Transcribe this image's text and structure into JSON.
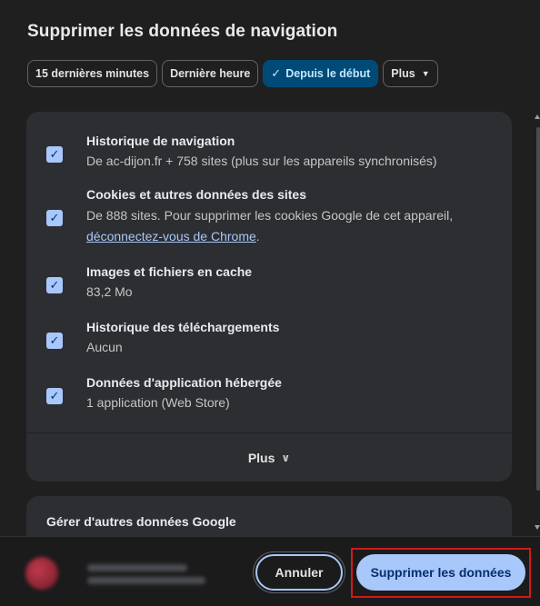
{
  "dialog": {
    "title": "Supprimer les données de navigation"
  },
  "time_ranges": [
    {
      "label": "15 dernières minutes",
      "selected": false
    },
    {
      "label": "Dernière heure",
      "selected": false
    },
    {
      "label": "Depuis le début",
      "selected": true
    },
    {
      "label": "Plus",
      "selected": false
    }
  ],
  "items": [
    {
      "title": "Historique de navigation",
      "subtitle": "De ac-dijon.fr + 758 sites (plus sur les appareils synchronisés)",
      "checked": true
    },
    {
      "title": "Cookies et autres données des sites",
      "subtitle": "De 888 sites. Pour supprimer les cookies Google de cet appareil,",
      "link": "déconnectez-vous de Chrome",
      "link_suffix": ".",
      "checked": true
    },
    {
      "title": "Images et fichiers en cache",
      "subtitle": "83,2 Mo",
      "checked": true
    },
    {
      "title": "Historique des téléchargements",
      "subtitle": "Aucun",
      "checked": true
    },
    {
      "title": "Données d'application hébergée",
      "subtitle": "1 application (Web Store)",
      "checked": true
    }
  ],
  "more": {
    "label": "Plus",
    "icon": "chevron-down-icon"
  },
  "google_section": {
    "title": "Gérer d'autres données Google"
  },
  "footer": {
    "cancel_label": "Annuler",
    "delete_label": "Supprimer les données"
  },
  "colors": {
    "accent": "#a8c7fa",
    "selected_chip": "#004a77",
    "highlight": "#d11a1a"
  }
}
